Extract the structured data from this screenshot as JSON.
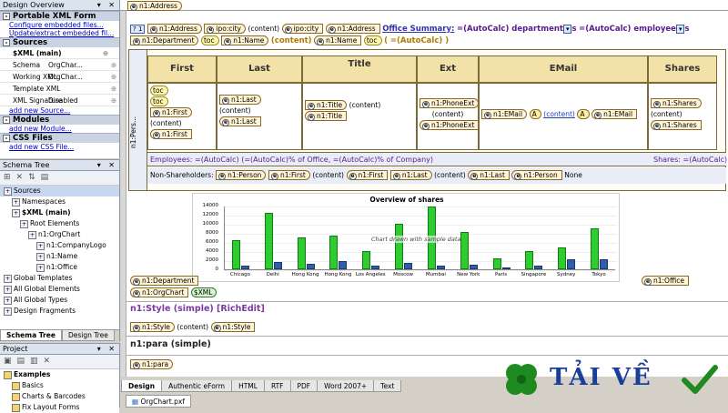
{
  "top_tag": "n1:Address",
  "left": {
    "design_overview_title": "Design Overview",
    "sections": {
      "xml_form": "Portable XML Form",
      "xml_links": [
        "Configure embedded files...",
        "Update/extract embedded fil..."
      ],
      "sources": "Sources",
      "source_name": "$XML (main)",
      "props": [
        {
          "k": "Schema",
          "v": "OrgChar..."
        },
        {
          "k": "Working XML",
          "v": "OrgChar..."
        },
        {
          "k": "Template XML",
          "v": ""
        },
        {
          "k": "XML Signature",
          "v": "Disabled"
        }
      ],
      "add_source": "add new Source...",
      "modules": "Modules",
      "add_module": "add new Module...",
      "css_files": "CSS Files",
      "add_css": "add new CSS File..."
    },
    "schema_tree_title": "Schema Tree",
    "schema_nodes": [
      {
        "label": "Sources",
        "indent": 0,
        "sel": true
      },
      {
        "label": "Namespaces",
        "indent": 1
      },
      {
        "label": "$XML (main)",
        "indent": 1,
        "bold": true
      },
      {
        "label": "Root Elements",
        "indent": 2
      },
      {
        "label": "n1:OrgChart",
        "indent": 3
      },
      {
        "label": "n1:CompanyLogo",
        "indent": 4
      },
      {
        "label": "n1:Name",
        "indent": 4
      },
      {
        "label": "n1:Office",
        "indent": 4
      },
      {
        "label": "Global Templates",
        "indent": 0
      },
      {
        "label": "All Global Elements",
        "indent": 0
      },
      {
        "label": "All Global Types",
        "indent": 0
      },
      {
        "label": "Design Fragments",
        "indent": 0
      }
    ],
    "schema_tabs": [
      "Schema Tree",
      "Design Tree"
    ],
    "project_title": "Project",
    "project_nodes": [
      {
        "label": "Examples",
        "indent": 0
      },
      {
        "label": "Basics",
        "indent": 1
      },
      {
        "label": "Charts & Barcodes",
        "indent": 1
      },
      {
        "label": "Fix Layout Forms",
        "indent": 1
      }
    ]
  },
  "design": {
    "row1_tags": [
      "n1:Address",
      "ipo:city",
      "(content)",
      "ipo:city",
      "n1:Address"
    ],
    "office_summary": "Office Summary:",
    "office_auto1": "=(AutoCalc) department",
    "office_auto2": "s",
    "office_auto3": "=(AutoCalc) employee",
    "office_auto4": "s",
    "row2_tags": [
      "n1:Department",
      "toc",
      "n1:Name",
      "(content)",
      "n1:Name",
      "toc"
    ],
    "row2_auto": "( =(AutoCalc) )",
    "headers": [
      "First",
      "Last",
      "Title",
      "Ext",
      "EMail",
      "Shares"
    ],
    "person_tag": "n1:Pers...",
    "cells": {
      "first": [
        "toc",
        "toc",
        "n1:First",
        "(content)",
        "n1:First"
      ],
      "last": [
        "n1:Last",
        "(content)",
        "n1:Last"
      ],
      "title": [
        "n1:Title",
        "(content)",
        "n1:Title"
      ],
      "ext": [
        "n1:PhoneExt",
        "(content)",
        "n1:PhoneExt"
      ],
      "email": [
        "n1:EMail",
        "A",
        "(content)",
        "A",
        "n1:EMail"
      ],
      "shares": [
        "n1:Shares",
        "(content)",
        "n1:Shares"
      ]
    },
    "employees_line": "Employees: =(AutoCalc) (=(AutoCalc)% of Office, =(AutoCalc)% of Company)",
    "shares_line": "Shares: =(AutoCalc) (=(AutoC",
    "nonshare_label": "Non-Shareholders:",
    "nonshare_tags": [
      "n1:Person",
      "n1:First",
      "(content)",
      "n1:First",
      "n1:Last",
      "(content)",
      "n1:Last",
      "n1:Person"
    ],
    "nonshare_none": "None",
    "dept_tag": "n1:Department",
    "orgchart_tag": "n1:OrgChart",
    "xml_tag": "$XML",
    "office_tag": "n1:Office",
    "style_title": "n1:Style (simple) [RichEdit]",
    "style_tags": [
      "n1:Style",
      "(content)",
      "n1:Style"
    ],
    "para_title": "n1:para (simple)",
    "para_tag": "n1:para"
  },
  "bottom_tabs": [
    "Design",
    "Authentic eForm",
    "HTML",
    "RTF",
    "PDF",
    "Word 2007+",
    "Text"
  ],
  "file_tab": "OrgChart.pxf",
  "watermark": "TẢI VỀ",
  "chart_data": {
    "type": "bar",
    "title": "Overview of shares",
    "annotation": "Chart drawn with sample data",
    "categories": [
      "Chicago",
      "Delhi",
      "Hong Kong",
      "Hong Kong",
      "Los Angeles",
      "Moscow",
      "Mumbai",
      "New York",
      "Paris",
      "Singapore",
      "Sydney",
      "Tokyo"
    ],
    "series": [
      {
        "values": [
          6500,
          12500,
          7000,
          7500,
          4000,
          10000,
          13800,
          8200,
          2500,
          4000,
          4800,
          9000
        ],
        "color": "#2ecc2e"
      },
      {
        "values": [
          800,
          1600,
          1200,
          1800,
          900,
          1500,
          800,
          1000,
          400,
          900,
          2200,
          2200
        ],
        "color": "#2f5fa8"
      }
    ],
    "ylim": [
      0,
      14000
    ],
    "yticks": [
      "14000",
      "12000",
      "10000",
      "8000",
      "6000",
      "4000",
      "2000",
      "0"
    ]
  }
}
